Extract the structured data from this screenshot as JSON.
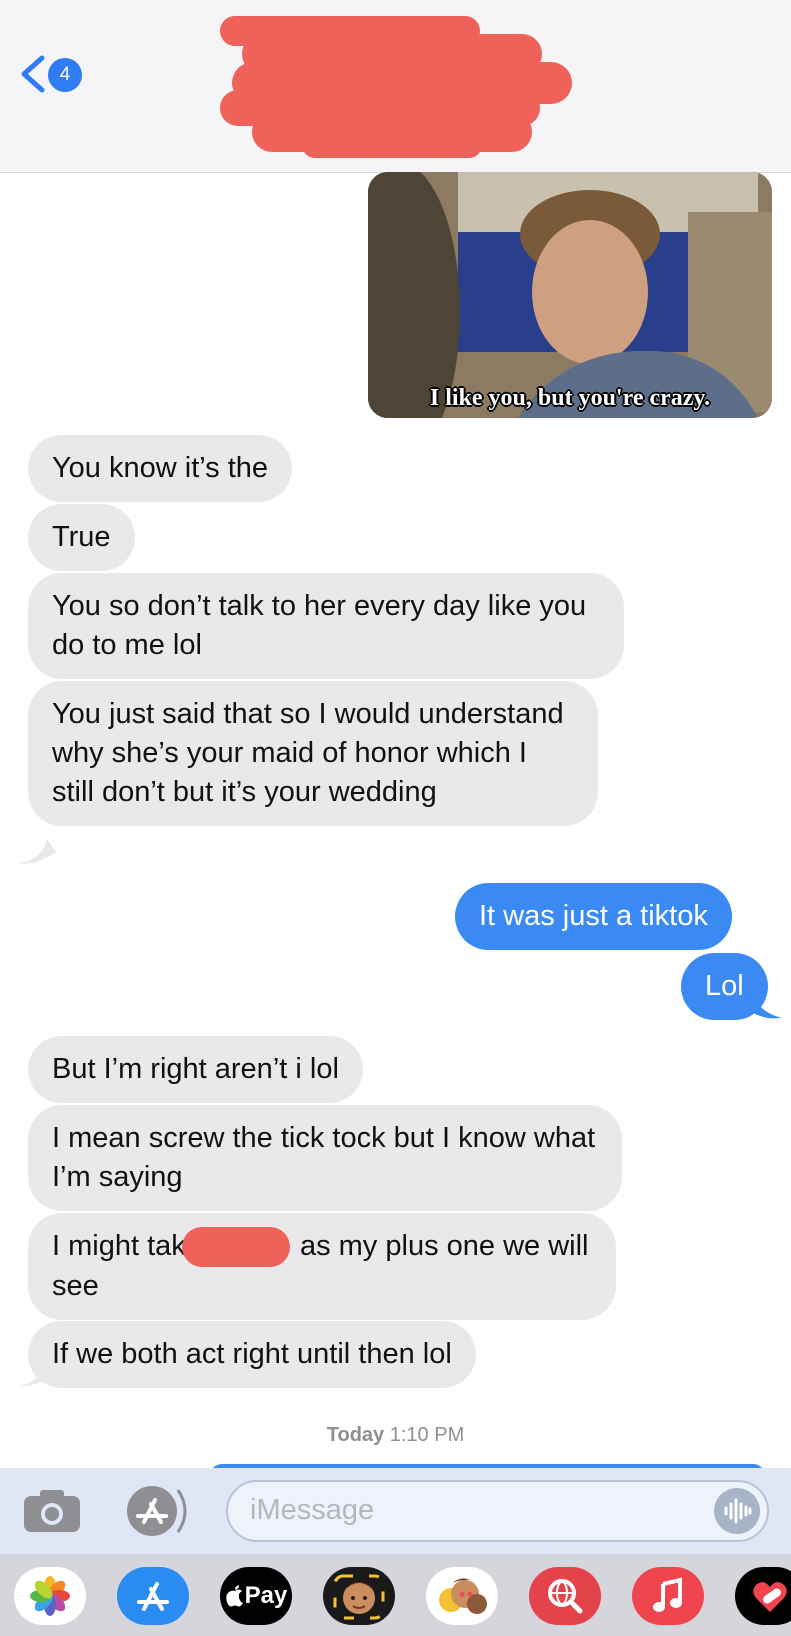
{
  "header": {
    "back_count": "4"
  },
  "meme": {
    "caption": "I like you, but you're crazy."
  },
  "messages": [
    {
      "from": "them",
      "text": "You know it’s the"
    },
    {
      "from": "them",
      "text": "True"
    },
    {
      "from": "them",
      "text": "You so don’t talk to her every day like you do to me lol"
    },
    {
      "from": "them",
      "text": "You just said that so I would understand why she’s your maid of honor which I still don’t but it’s your wedding"
    },
    {
      "from": "me",
      "text": "It was just a tiktok"
    },
    {
      "from": "me",
      "text": "Lol"
    },
    {
      "from": "them",
      "text": "But I’m right aren’t i lol"
    },
    {
      "from": "them",
      "text": "I mean screw the tick tock but I know what I’m saying"
    },
    {
      "from": "them",
      "text_before": "I might take",
      "text_after": "as my plus one we will see"
    },
    {
      "from": "them",
      "text": "If we both act right until then lol"
    }
  ],
  "timestamp": {
    "day": "Today",
    "time": "1:10 PM"
  },
  "composer": {
    "placeholder": "iMessage"
  },
  "app_drawer": {
    "apple_pay_label": "Pay",
    "apps": [
      "photos-app-icon",
      "app-store-icon",
      "apple-pay-icon",
      "memoji-icon",
      "animoji-stickers-icon",
      "image-search-icon",
      "music-app-icon",
      "digital-touch-icon"
    ]
  },
  "colors": {
    "sent_bubble": "#3b8af4",
    "received_bubble": "#e9e9eb",
    "redaction": "#ef6259",
    "link_blue": "#2f7cf6"
  }
}
